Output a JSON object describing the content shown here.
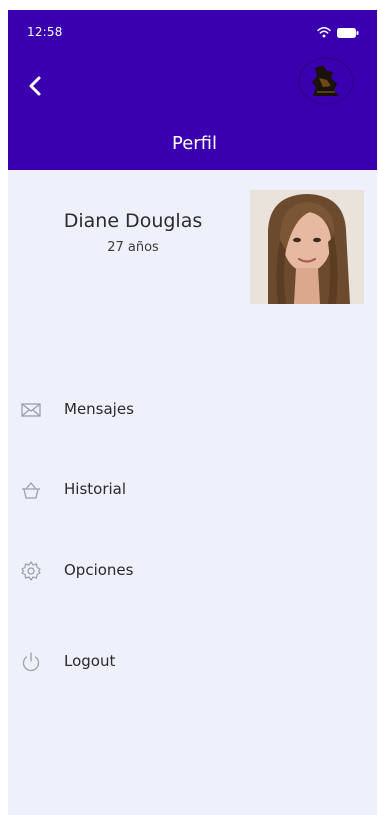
{
  "status_bar": {
    "time": "12:58",
    "icons": [
      "wifi-icon",
      "battery-icon"
    ]
  },
  "header": {
    "title": "Perfil",
    "back_icon": "chevron-left-icon",
    "logo": "app-logo"
  },
  "profile": {
    "name": "Diane Douglas",
    "age": "27 años"
  },
  "menu": {
    "items": [
      {
        "label": "Mensajes",
        "icon": "envelope-icon"
      },
      {
        "label": "Historial",
        "icon": "basket-icon"
      },
      {
        "label": "Opciones",
        "icon": "gear-icon"
      },
      {
        "label": "Logout",
        "icon": "power-icon"
      }
    ]
  },
  "colors": {
    "header": "#3a00b0",
    "background": "#eef0fb",
    "icon": "#9aa0ad"
  }
}
